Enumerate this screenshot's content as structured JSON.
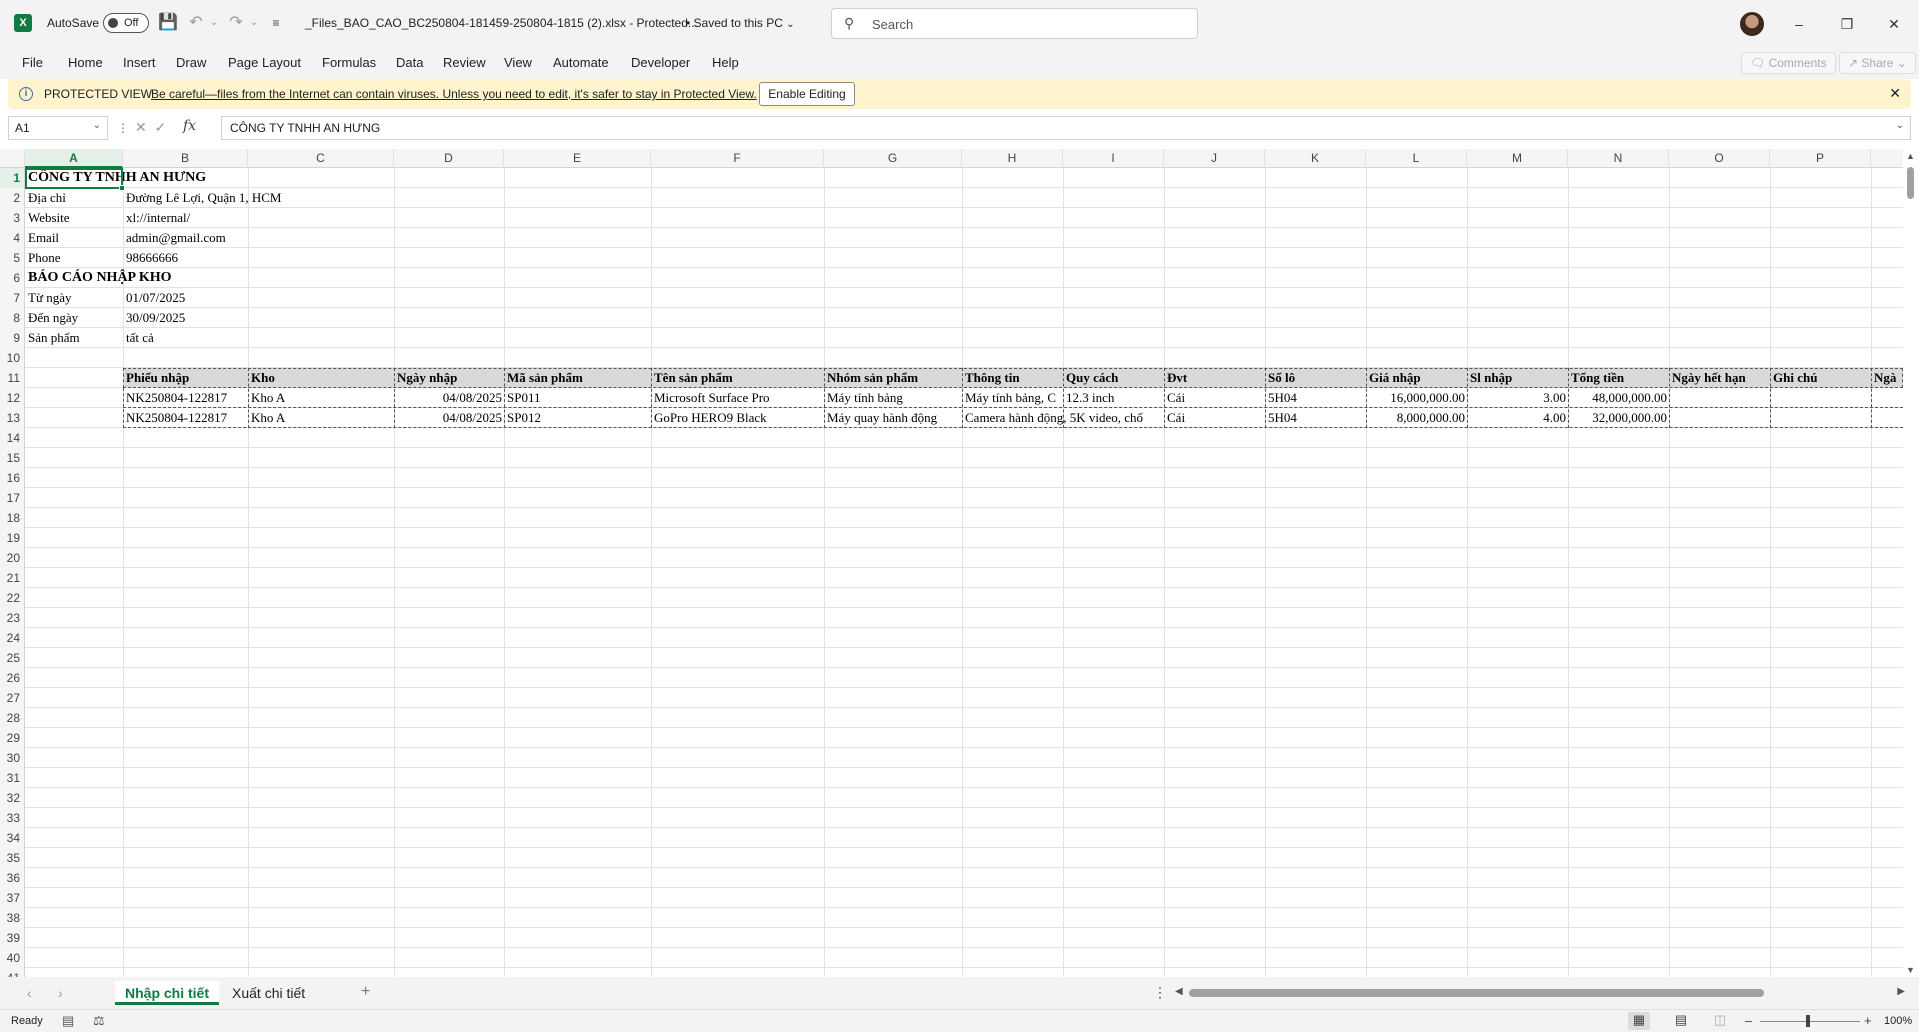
{
  "titlebar": {
    "autosave_label": "AutoSave",
    "autosave_state": "Off",
    "doc_title": "_Files_BAO_CAO_BC250804-181459-250804-1815 (2).xlsx  -  Protected...",
    "saved_status": "•  Saved to this PC",
    "search_placeholder": "Search"
  },
  "ribbon": {
    "tabs": [
      "File",
      "Home",
      "Insert",
      "Draw",
      "Page Layout",
      "Formulas",
      "Data",
      "Review",
      "View",
      "Automate",
      "Developer",
      "Help"
    ],
    "comments_label": "Comments",
    "share_label": "Share"
  },
  "protected": {
    "title": "PROTECTED VIEW",
    "message": "Be careful—files from the Internet can contain viruses. Unless you need to edit, it's safer to stay in Protected View.",
    "enable_label": "Enable Editing"
  },
  "formula_bar": {
    "name_box": "A1",
    "fx": "fx",
    "content": "CÔNG TY TNHH AN HƯNG"
  },
  "columns": [
    "A",
    "B",
    "C",
    "D",
    "E",
    "F",
    "G",
    "H",
    "I",
    "J",
    "K",
    "L",
    "M",
    "N",
    "O",
    "P"
  ],
  "rows": [
    "1",
    "2",
    "3",
    "4",
    "5",
    "6",
    "7",
    "8",
    "9",
    "10",
    "11",
    "12",
    "13",
    "14",
    "15",
    "16",
    "17",
    "18",
    "19",
    "20",
    "21",
    "22",
    "23",
    "24",
    "25",
    "26",
    "27",
    "28",
    "29",
    "30",
    "31",
    "32",
    "33",
    "34",
    "35",
    "36",
    "37",
    "38",
    "39",
    "40",
    "41"
  ],
  "sheet": {
    "company": "CÔNG TY TNHH AN HƯNG",
    "info": [
      {
        "label": "Địa chỉ",
        "value": "Đường Lê Lợi, Quận 1, HCM"
      },
      {
        "label": "Website",
        "value": "xl://internal/"
      },
      {
        "label": "Email",
        "value": "admin@gmail.com"
      },
      {
        "label": "Phone",
        "value": "98666666"
      }
    ],
    "report_title": "BÁO CÁO NHẬP KHO",
    "filters": [
      {
        "label": "Từ ngày",
        "value": "01/07/2025"
      },
      {
        "label": "Đến ngày",
        "value": "30/09/2025"
      },
      {
        "label": "Sản phẩm",
        "value": "tất cả"
      }
    ],
    "table_headers": [
      "Phiếu nhập",
      "Kho",
      "Ngày nhập",
      "Mã sản phẩm",
      "Tên sản phẩm",
      "Nhóm sản phẩm",
      "Thông tin",
      "Quy cách",
      "Đvt",
      "Số lô",
      "Giá nhập",
      "Sl nhập",
      "Tổng tiền",
      "Ngày hết hạn",
      "Ghi chú",
      "Ngà"
    ],
    "table_rows": [
      [
        "NK250804-122817",
        "Kho A",
        "04/08/2025",
        "SP011",
        "Microsoft Surface Pro",
        "Máy tính bảng",
        "Máy tính bảng, C",
        "12.3 inch",
        "Cái",
        "5H04",
        "16,000,000.00",
        "3.00",
        "48,000,000.00",
        "",
        "",
        ""
      ],
      [
        "NK250804-122817",
        "Kho A",
        "04/08/2025",
        "SP012",
        "GoPro HERO9 Black",
        "Máy quay hành động",
        "Camera hành động, 5K video, chố",
        "",
        "Cái",
        "5H04",
        "8,000,000.00",
        "4.00",
        "32,000,000.00",
        "",
        "",
        ""
      ]
    ]
  },
  "sheet_tabs": [
    "Nhập chi tiết",
    "Xuất chi tiết"
  ],
  "status": {
    "ready": "Ready",
    "zoom": "100%"
  }
}
